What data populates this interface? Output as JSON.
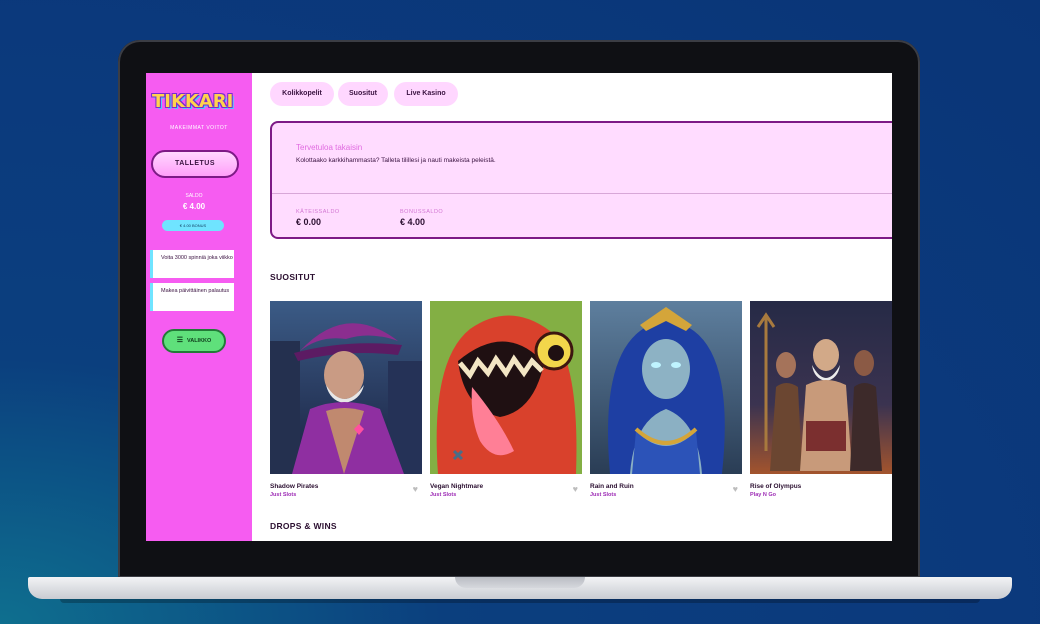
{
  "sidebar": {
    "logo": "TIKKARI",
    "tagline": "MAKEIMMAT VOITOT",
    "deposit_label": "TALLETUS",
    "saldo_label": "SALDO",
    "saldo_value": "€ 4.00",
    "bonus_pill": "€ 4.00 BONUS",
    "promos": [
      "Voita 3000 spinniä joka viikko",
      "Makea päivittäinen palautus"
    ],
    "menu_label": "VALIKKO"
  },
  "tabs": [
    "Kolikkopelit",
    "Suositut",
    "Live Kasino"
  ],
  "welcome": {
    "title": "Tervetuloa takaisin",
    "text": "Kolottaako karkkihammasta? Talleta tilillesi ja nauti makeista peleistä.",
    "cash_label": "KÄTEISSALDO",
    "cash_value": "€ 0.00",
    "bonus_label": "BONUSSALDO",
    "bonus_value": "€ 4.00"
  },
  "sections": {
    "suositut": "SUOSITUT",
    "drops": "DROPS & WINS"
  },
  "games": [
    {
      "name": "Shadow Pirates",
      "provider": "Just Slots"
    },
    {
      "name": "Vegan Nightmare",
      "provider": "Just Slots"
    },
    {
      "name": "Rain and Ruin",
      "provider": "Just Slots"
    },
    {
      "name": "Rise of Olympus",
      "provider": "Play N Go"
    }
  ],
  "colors": {
    "sidebar_bg": "#f65cf1",
    "card_bg": "#ffdcff",
    "accent_purple": "#7d1a86",
    "menu_green": "#5fe07b"
  }
}
